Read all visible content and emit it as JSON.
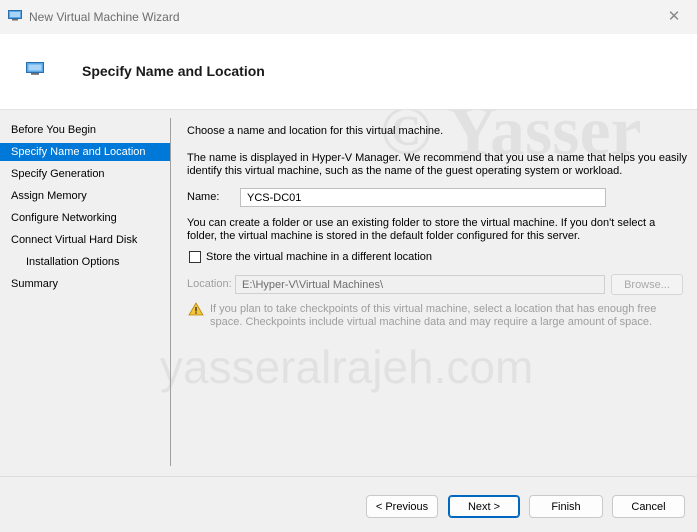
{
  "window": {
    "title": "New Virtual Machine Wizard"
  },
  "header": {
    "title": "Specify Name and Location"
  },
  "nav": {
    "items": [
      {
        "label": "Before You Begin"
      },
      {
        "label": "Specify Name and Location"
      },
      {
        "label": "Specify Generation"
      },
      {
        "label": "Assign Memory"
      },
      {
        "label": "Configure Networking"
      },
      {
        "label": "Connect Virtual Hard Disk"
      },
      {
        "label": "Installation Options"
      },
      {
        "label": "Summary"
      }
    ]
  },
  "content": {
    "intro": "Choose a name and location for this virtual machine.",
    "desc_line1": "The name is displayed in Hyper-V Manager. We recommend that you use a name that helps you easily",
    "desc_line2": "identify this virtual machine, such as the name of the guest operating system or workload.",
    "name_label": "Name:",
    "name_value": "YCS-DC01",
    "folder_line1": "You can create a folder or use an existing folder to store the virtual machine. If you don't select a",
    "folder_line2": "folder, the virtual machine is stored in the default folder configured for this server.",
    "checkbox_label": "Store the virtual machine in a different location",
    "location_label": "Location:",
    "location_value": "E:\\Hyper-V\\Virtual Machines\\",
    "browse_label": "Browse...",
    "warning_line1": "If you plan to take checkpoints of this virtual machine, select a location that has enough free",
    "warning_line2": "space. Checkpoints include virtual machine data and may require a large amount of space."
  },
  "buttons": {
    "previous": "< Previous",
    "next": "Next >",
    "finish": "Finish",
    "cancel": "Cancel"
  },
  "colors": {
    "accent": "#0078d7",
    "warning": "#e3a21a"
  }
}
